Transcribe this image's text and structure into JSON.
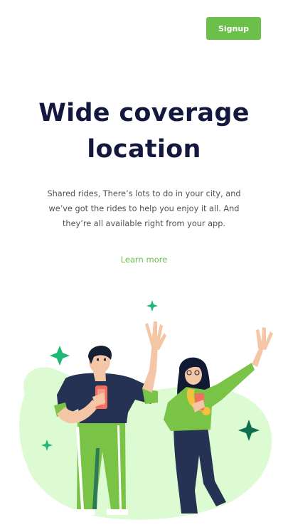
{
  "header": {
    "signup_label": "Signup"
  },
  "hero": {
    "title_line1": "Wide coverage",
    "title_line2": "location",
    "description_line1": "Shared rides, There’s lots to do in your city, and",
    "description_line2": "we’ve got the rides to help you enjoy it all. And",
    "description_line3": "they’re all available right from your app.",
    "learn_more_label": "Learn more"
  },
  "colors": {
    "accent_green": "#6cc04a",
    "heading_navy": "#14183e",
    "sparkle_green": "#1fb877",
    "blob_green": "#dcfbd2"
  },
  "illustration": {
    "name": "two-people-waving-illustration"
  }
}
